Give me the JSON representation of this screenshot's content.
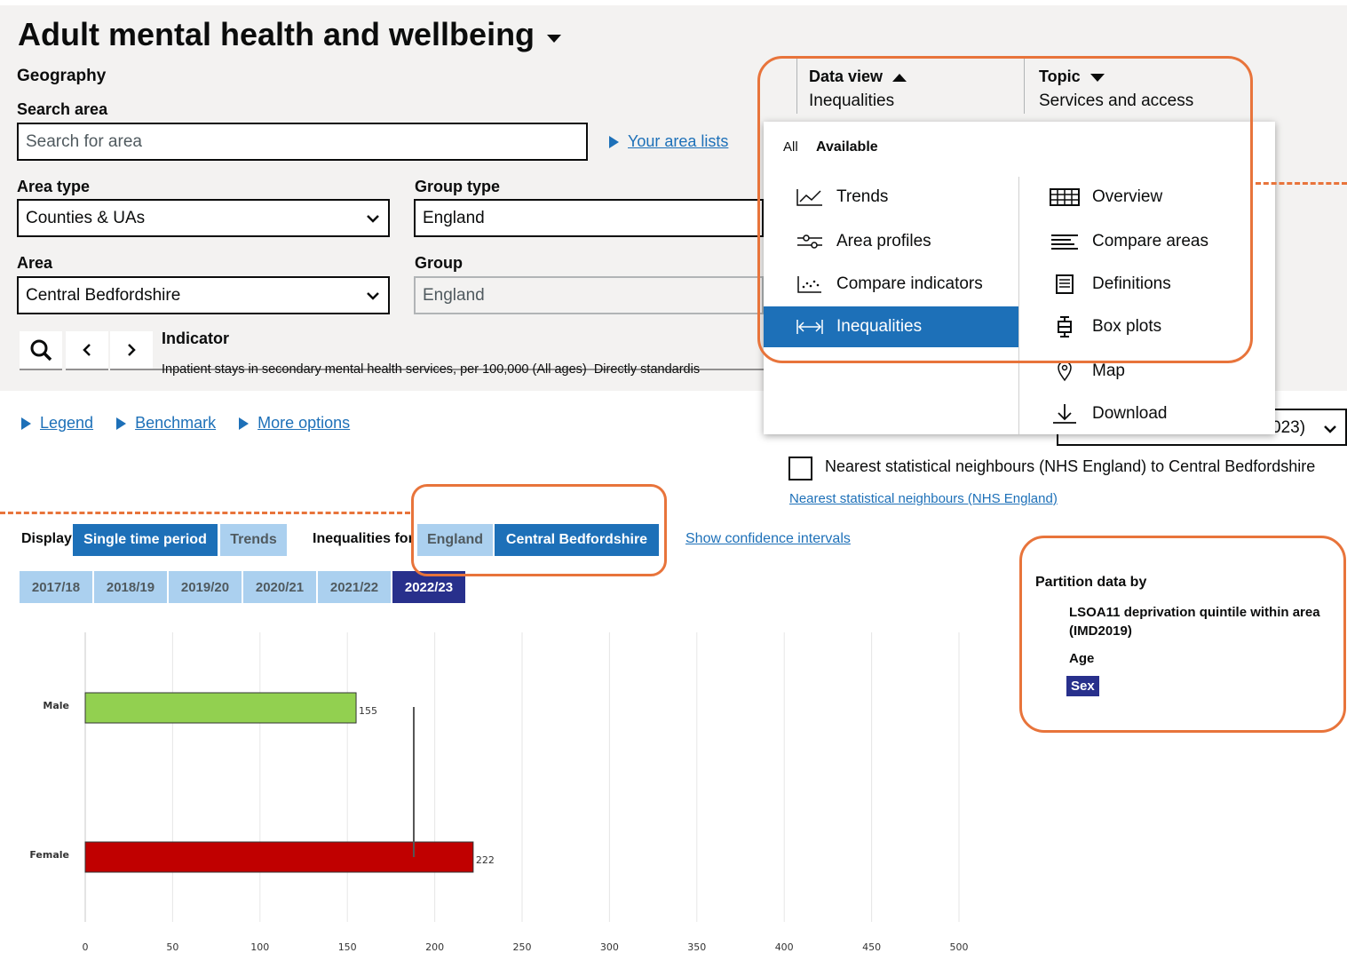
{
  "title": "Adult mental health and wellbeing",
  "geography": {
    "heading": "Geography",
    "search_label": "Search area",
    "search_placeholder": "Search for area",
    "area_lists_link": "Your area lists",
    "area_type_label": "Area type",
    "area_type_value": "Counties & UAs",
    "group_type_label": "Group type",
    "group_type_value": "England",
    "area_label": "Area",
    "area_value": "Central Bedfordshire",
    "group_label": "Group",
    "group_value": "England"
  },
  "indicator": {
    "label": "Indicator",
    "text": "Inpatient stays in secondary mental health services, per 100,000 (All ages)  Directly standardis"
  },
  "data_view": {
    "label": "Data view",
    "value": "Inequalities"
  },
  "topic": {
    "label": "Topic",
    "value": "Services and access"
  },
  "dropdown": {
    "tab_all": "All",
    "tab_available": "Available",
    "left_items": [
      {
        "label": "Trends",
        "icon": "trends-icon"
      },
      {
        "label": "Area profiles",
        "icon": "sliders-icon"
      },
      {
        "label": "Compare indicators",
        "icon": "scatter-icon"
      },
      {
        "label": "Inequalities",
        "icon": "arrows-horizontal-icon"
      }
    ],
    "right_items": [
      {
        "label": "Overview",
        "icon": "grid-icon"
      },
      {
        "label": "Compare areas",
        "icon": "lines-icon"
      },
      {
        "label": "Definitions",
        "icon": "document-icon"
      },
      {
        "label": "Box plots",
        "icon": "boxplot-icon"
      },
      {
        "label": "Map",
        "icon": "pin-icon"
      },
      {
        "label": "Download",
        "icon": "download-icon"
      }
    ]
  },
  "options_links": {
    "legend": "Legend",
    "benchmark": "Benchmark",
    "more_options": "More options"
  },
  "period_select_fragment": "023)",
  "neighbours": {
    "checkbox_label": "Nearest statistical neighbours (NHS England) to Central Bedfordshire",
    "link": "Nearest statistical neighbours (NHS England)"
  },
  "display": {
    "label": "Display",
    "single": "Single time period",
    "trends": "Trends",
    "inequalities_for_label": "Inequalities for",
    "england": "England",
    "area": "Central Bedfordshire",
    "confidence_link": "Show confidence intervals"
  },
  "years": [
    "2017/18",
    "2018/19",
    "2019/20",
    "2020/21",
    "2021/22",
    "2022/23"
  ],
  "selected_year": "2022/23",
  "partition": {
    "heading": "Partition data by",
    "option1": "LSOA11 deprivation quintile within area (IMD2019)",
    "option2": "Age",
    "option3": "Sex"
  },
  "colors": {
    "accent": "#1d70b8",
    "highlight": "#e8743b",
    "male_bar": "#92d050",
    "female_bar": "#c00000",
    "selected": "#28308c"
  },
  "chart_data": {
    "type": "bar",
    "orientation": "horizontal",
    "categories": [
      "Male",
      "Female"
    ],
    "values": [
      155,
      222
    ],
    "bar_colors": [
      "#92d050",
      "#c00000"
    ],
    "reference_line": 188,
    "xlim": [
      0,
      500
    ],
    "xticks": [
      0,
      50,
      100,
      150,
      200,
      250,
      300,
      350,
      400,
      450,
      500
    ],
    "grid": true
  }
}
